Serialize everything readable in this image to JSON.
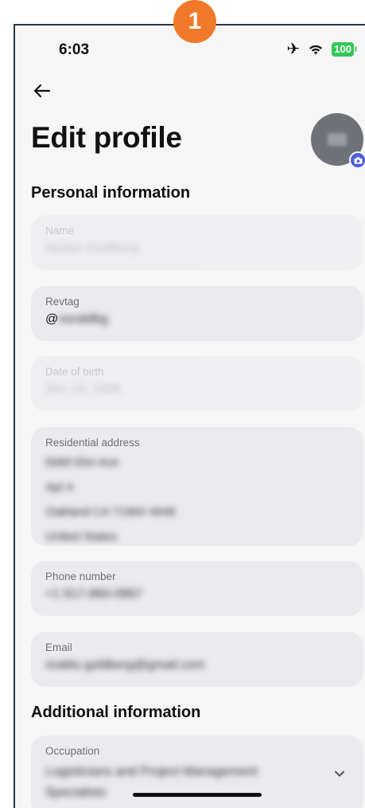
{
  "annotation": {
    "badge_number": "1",
    "color": "#f07a2a"
  },
  "status_bar": {
    "time": "6:03",
    "battery": "100"
  },
  "header": {
    "title": "Edit profile"
  },
  "sections": {
    "personal": "Personal information",
    "additional": "Additional information"
  },
  "fields": {
    "name": {
      "label": "Name",
      "value": "Nurlan Goldberg"
    },
    "revtag": {
      "label": "Revtag",
      "prefix": "@",
      "value": "nuraldbg"
    },
    "dob": {
      "label": "Date of birth",
      "value": "Dec 10, 1990"
    },
    "address": {
      "label": "Residential address",
      "lines": [
        "5060 Elm Ave",
        "Apt 4",
        "Oakland CA 71964 4948",
        "United States"
      ]
    },
    "phone": {
      "label": "Phone number",
      "value": "+1 617-860-0867"
    },
    "email": {
      "label": "Email",
      "value": "nraldo.goldberg@gmail.com"
    },
    "occupation": {
      "label": "Occupation",
      "value_line1": "Logisticians and Project Management",
      "value_line2": "Specialists"
    }
  },
  "colors": {
    "accent": "#4d5ed9",
    "battery": "#34c759"
  }
}
